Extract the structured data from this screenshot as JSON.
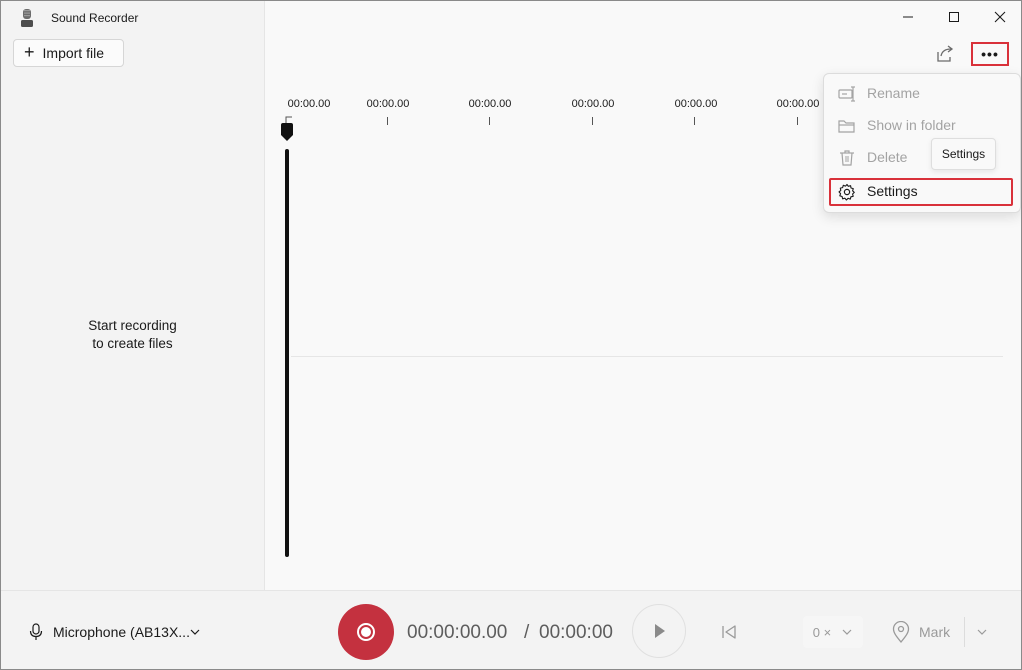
{
  "app": {
    "title": "Sound Recorder"
  },
  "sidebar": {
    "import_label": "Import file",
    "empty_line1": "Start recording",
    "empty_line2": "to create files"
  },
  "timeline": {
    "ticks": [
      "00:00.00",
      "00:00.00",
      "00:00.00",
      "00:00.00",
      "00:00.00",
      "00:00.00"
    ]
  },
  "menu": {
    "items": [
      {
        "label": "Rename",
        "icon": "rename-icon",
        "enabled": false
      },
      {
        "label": "Show in folder",
        "icon": "folder-icon",
        "enabled": false
      },
      {
        "label": "Delete",
        "icon": "trash-icon",
        "enabled": false
      },
      {
        "label": "Settings",
        "icon": "gear-icon",
        "enabled": true
      }
    ],
    "tooltip": "Settings"
  },
  "bottom": {
    "mic_label": "Microphone (AB13X...",
    "current_time": "00:00:00.00",
    "separator": "/",
    "total_time": "00:00:00",
    "speed_label": "0 ×",
    "mark_label": "Mark"
  },
  "colors": {
    "record": "#c4313f",
    "highlight": "#d9313a"
  }
}
